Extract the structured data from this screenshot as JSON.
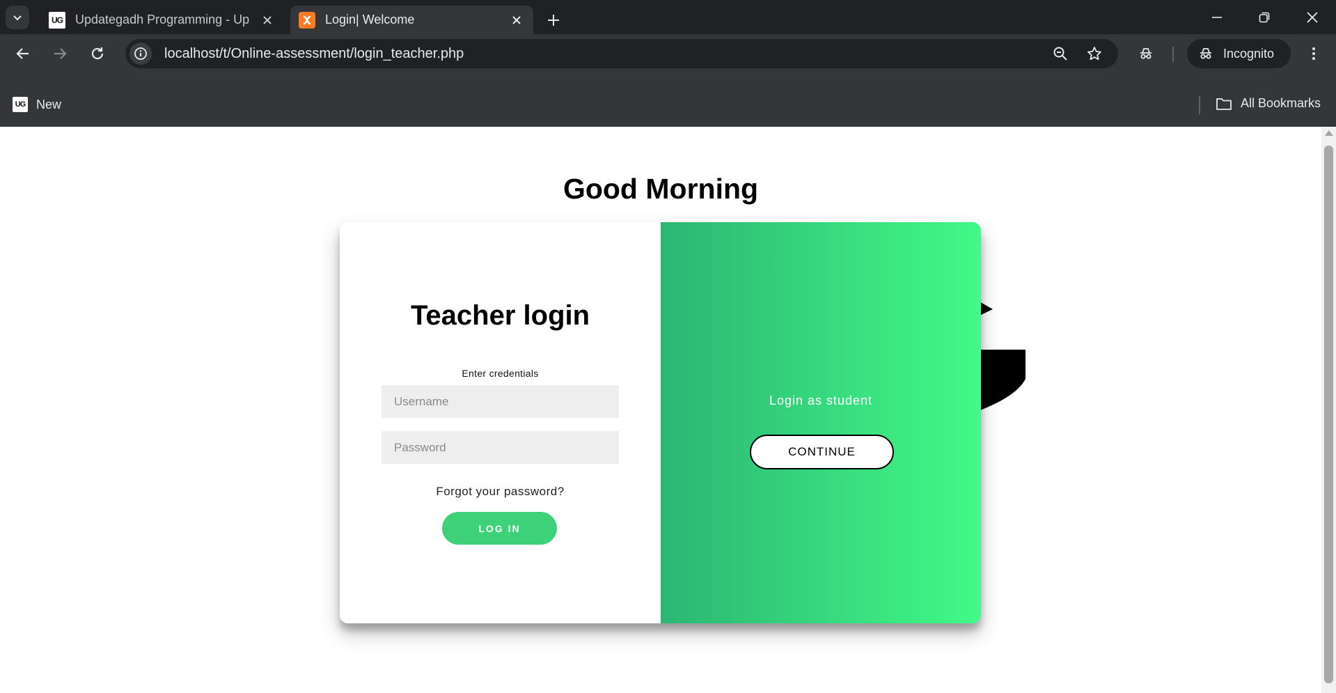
{
  "browser": {
    "tabs": [
      {
        "title": "Updategadh Programming - Up",
        "favicon": "UG"
      },
      {
        "title": "Login| Welcome",
        "favicon": "xampp-icon"
      }
    ],
    "url": "localhost/t/Online-assessment/login_teacher.php",
    "incognito_label": "Incognito",
    "bookmarks": [
      {
        "label": "New",
        "favicon": "UG"
      }
    ],
    "all_bookmarks_label": "All Bookmarks"
  },
  "page": {
    "greeting": "Good Morning",
    "login": {
      "title": "Teacher login",
      "subtitle": "Enter credentials",
      "username_placeholder": "Username",
      "password_placeholder": "Password",
      "forgot_label": "Forgot your password?",
      "login_button": "LOG IN"
    },
    "overlay": {
      "text": "Login as student",
      "button": "CONTINUE"
    }
  },
  "colors": {
    "chrome_dark": "#202124",
    "chrome_toolbar": "#35363a",
    "accent_green": "#3dd279",
    "gradient_start": "#2cb673",
    "gradient_end": "#41fa87"
  }
}
